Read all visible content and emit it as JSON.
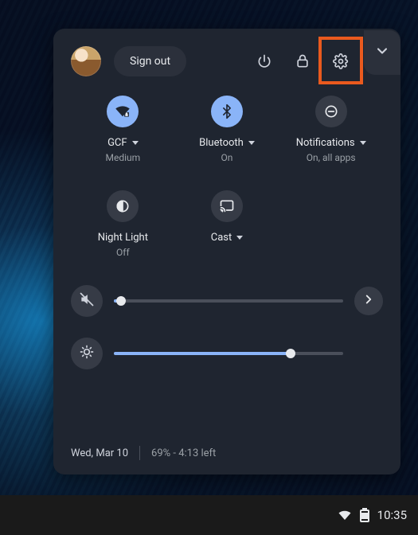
{
  "header": {
    "signout_label": "Sign out"
  },
  "tiles": {
    "wifi": {
      "label": "GCF",
      "sub": "Medium",
      "on": true
    },
    "bluetooth": {
      "label": "Bluetooth",
      "sub": "On",
      "on": true
    },
    "notifications": {
      "label": "Notifications",
      "sub": "On, all apps",
      "on": false
    },
    "nightlight": {
      "label": "Night Light",
      "sub": "Off",
      "on": false
    },
    "cast": {
      "label": "Cast",
      "sub": "",
      "on": false
    }
  },
  "sliders": {
    "volume": {
      "value": 3
    },
    "brightness": {
      "value": 77
    }
  },
  "footer": {
    "date": "Wed, Mar 10",
    "battery": "69% - 4:13 left"
  },
  "taskbar": {
    "time": "10:35"
  }
}
